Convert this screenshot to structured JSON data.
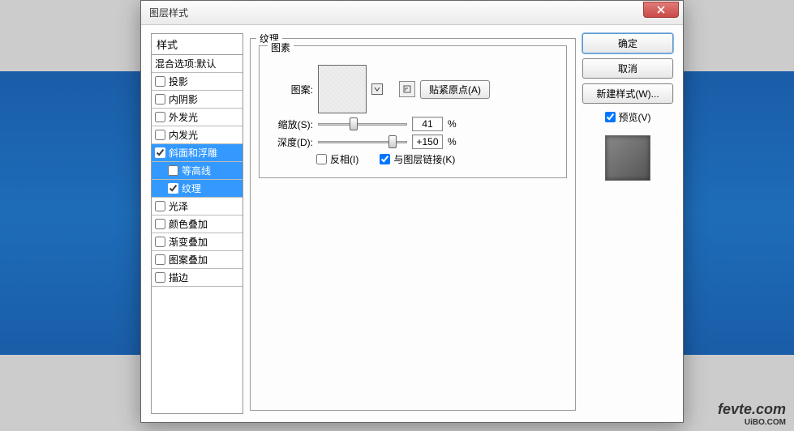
{
  "dialog": {
    "title": "图层样式"
  },
  "styles": {
    "header": "样式",
    "blend": "混合选项:默认",
    "items": {
      "dropShadow": "投影",
      "innerShadow": "内阴影",
      "outerGlow": "外发光",
      "innerGlow": "内发光",
      "bevelEmboss": "斜面和浮雕",
      "contour": "等高线",
      "texture": "纹理",
      "satin": "光泽",
      "colorOverlay": "颜色叠加",
      "gradientOverlay": "渐变叠加",
      "patternOverlay": "图案叠加",
      "stroke": "描边"
    }
  },
  "texture": {
    "groupLabel": "纹理",
    "elementGroup": "图素",
    "patternLabel": "图案:",
    "snapOrigin": "贴紧原点(A)",
    "scaleLabel": "缩放(S):",
    "scaleValue": "41",
    "scaleUnit": "%",
    "depthLabel": "深度(D):",
    "depthValue": "+150",
    "depthUnit": "%",
    "invert": "反相(I)",
    "linkWithLayer": "与图层链接(K)"
  },
  "buttons": {
    "ok": "确定",
    "cancel": "取消",
    "newStyle": "新建样式(W)...",
    "preview": "预览(V)"
  },
  "watermark": {
    "main": "fevte.com",
    "sub": "UiBO.COM"
  }
}
